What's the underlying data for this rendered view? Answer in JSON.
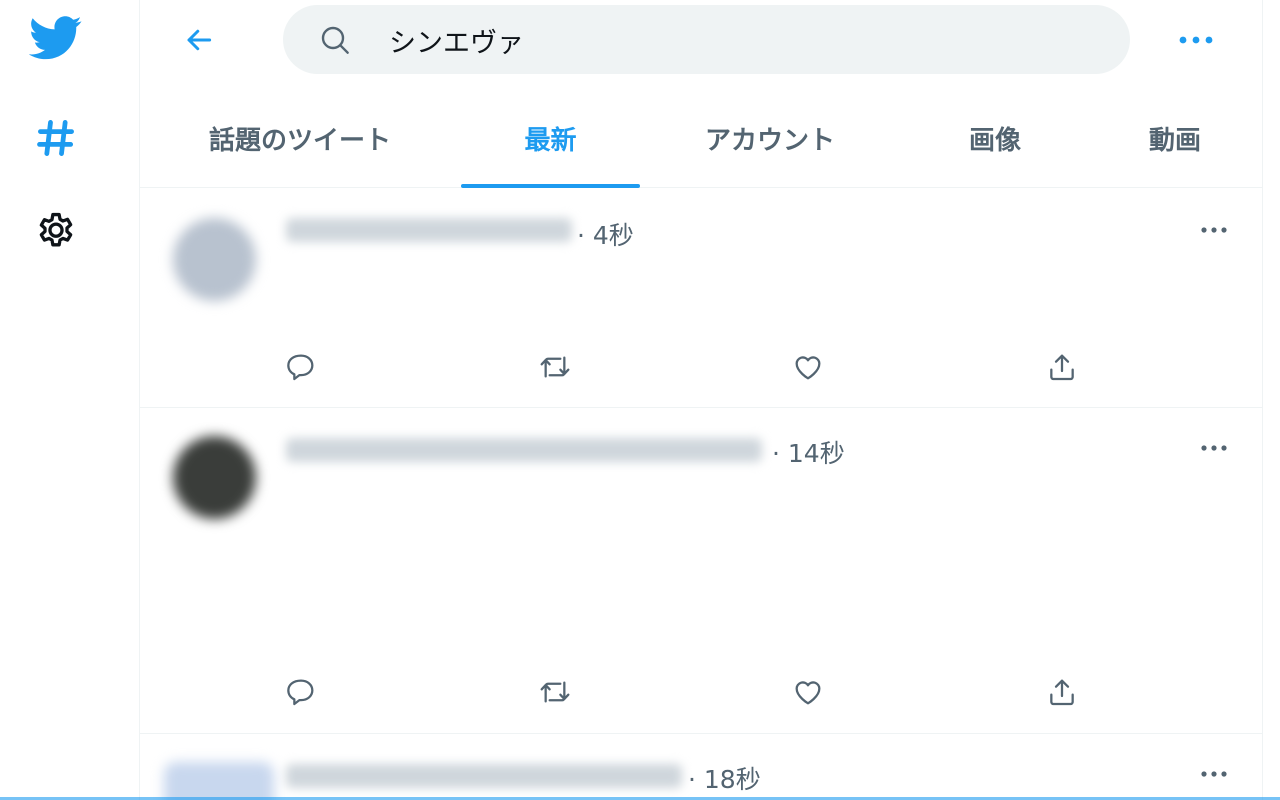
{
  "search": {
    "query": "シンエヴァ"
  },
  "tabs": [
    {
      "label": "話題のツイート"
    },
    {
      "label": "最新"
    },
    {
      "label": "アカウント"
    },
    {
      "label": "画像"
    },
    {
      "label": "動画"
    }
  ],
  "active_tab": "最新",
  "tweets": [
    {
      "time": "· 4秒"
    },
    {
      "time": "· 14秒"
    },
    {
      "time": "· 18秒"
    }
  ],
  "colors": {
    "accent": "#1d9bf0",
    "secondary_text": "#536471",
    "search_bg": "#eff3f4"
  },
  "icons": {
    "rail": [
      "twitter-bird-icon",
      "hashtag-icon",
      "gear-icon"
    ],
    "tweet_actions": [
      "reply-icon",
      "retweet-icon",
      "like-icon",
      "share-icon"
    ]
  }
}
